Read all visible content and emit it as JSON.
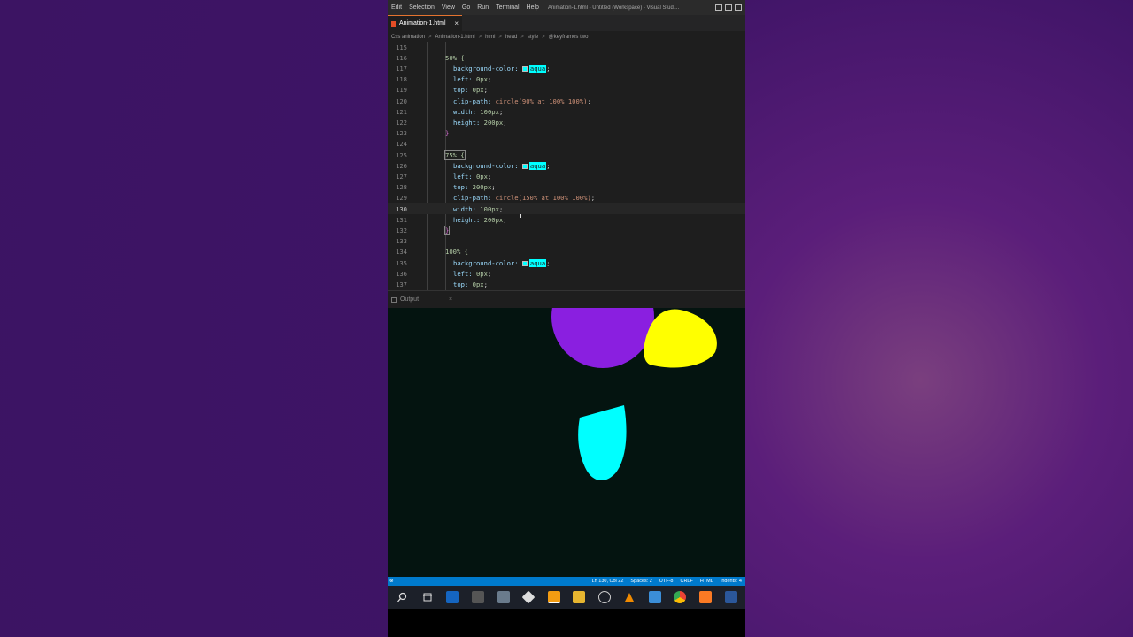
{
  "titlebar": {
    "menus": [
      "Edit",
      "Selection",
      "View",
      "Go",
      "Run",
      "Terminal",
      "Help"
    ],
    "window_title": "Animation-1.html - Untitled (Workspace) - Visual Studi..."
  },
  "tab": {
    "label": "Animation-1.html",
    "close": "×"
  },
  "breadcrumb": {
    "items": [
      "Css animation",
      "Animation-1.html",
      "html",
      "head",
      "style",
      "@keyframes two"
    ],
    "separator": ">"
  },
  "editor": {
    "active_line": 130,
    "lines": [
      {
        "n": "115",
        "text": ""
      },
      {
        "n": "116",
        "text": "50% {"
      },
      {
        "n": "117",
        "prop": "background-color:",
        "val": "aqua"
      },
      {
        "n": "118",
        "prop": "left:",
        "val": "0px"
      },
      {
        "n": "119",
        "prop": "top:",
        "val": "0px"
      },
      {
        "n": "120",
        "prop": "clip-path:",
        "val": "circle(90% at 100% 100%)"
      },
      {
        "n": "121",
        "prop": "width:",
        "val": "100px"
      },
      {
        "n": "122",
        "prop": "height:",
        "val": "200px"
      },
      {
        "n": "123",
        "text": "}"
      },
      {
        "n": "124",
        "text": ""
      },
      {
        "n": "125",
        "text": "75% {"
      },
      {
        "n": "126",
        "prop": "background-color:",
        "val": "aqua"
      },
      {
        "n": "127",
        "prop": "left:",
        "val": "0px"
      },
      {
        "n": "128",
        "prop": "top:",
        "val": "200px"
      },
      {
        "n": "129",
        "prop": "clip-path:",
        "val": "circle(150% at 100% 100%)"
      },
      {
        "n": "130",
        "prop": "width:",
        "val": "100px"
      },
      {
        "n": "131",
        "prop": "height:",
        "val": "200px"
      },
      {
        "n": "132",
        "text": "}"
      },
      {
        "n": "133",
        "text": ""
      },
      {
        "n": "134",
        "text": "100% {"
      },
      {
        "n": "135",
        "prop": "background-color:",
        "val": "aqua"
      },
      {
        "n": "136",
        "prop": "left:",
        "val": "0px"
      },
      {
        "n": "137",
        "prop": "top:",
        "val": "0px"
      }
    ]
  },
  "panel": {
    "title": "Output",
    "close": "×"
  },
  "preview": {
    "background": "#041410",
    "shapes": [
      {
        "name": "purple-circle",
        "color": "#8a1fe0"
      },
      {
        "name": "yellow-circle",
        "color": "#ffff00"
      },
      {
        "name": "aqua-drop",
        "color": "#00ffff"
      }
    ]
  },
  "statusbar": {
    "left": "⊗",
    "position": "Ln 130, Col 22",
    "spaces": "Spaces: 2",
    "encoding": "UTF-8",
    "eol": "CRLF",
    "language": "HTML",
    "indents": "Indents: 4"
  },
  "taskbar": {
    "icons": [
      "search-icon",
      "task-view-icon",
      "mail-icon",
      "calculator-icon",
      "camera-icon",
      "git-icon",
      "sublime-icon",
      "file-explorer-icon",
      "settings-icon",
      "vlc-icon",
      "vscode-icon",
      "chrome-icon",
      "xampp-icon",
      "word-icon"
    ]
  },
  "colors": {
    "accent": "#007acc",
    "aqua": "#00ffff",
    "purple": "#8a1fe0",
    "yellow": "#ffff00"
  }
}
